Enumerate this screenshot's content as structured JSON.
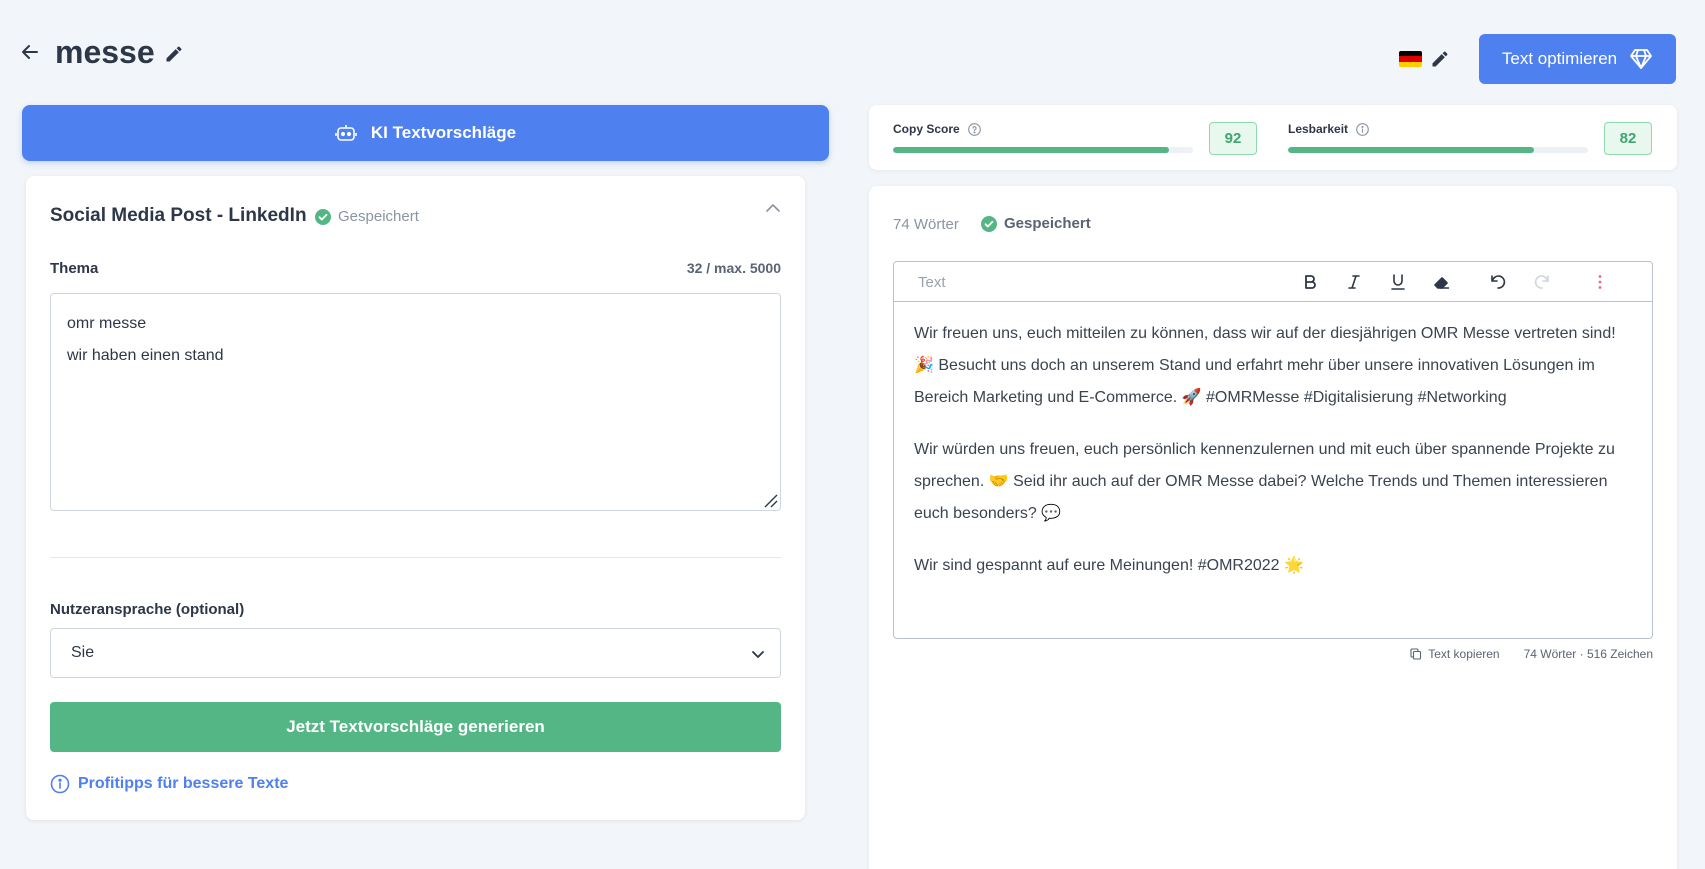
{
  "header": {
    "title": "messe",
    "back_icon": "arrow-left-icon",
    "edit_icon": "pencil-icon",
    "language_flag": "flag-de-icon",
    "optimize_button": "Text optimieren",
    "optimize_icon": "diamond-icon"
  },
  "colors": {
    "primary": "#4f80ef",
    "success": "#55b685",
    "background": "#f2f5f9",
    "text": "#2d3748"
  },
  "left_panel": {
    "ki_button": "KI Textvorschläge",
    "ki_icon": "robot-icon",
    "card_title": "Social Media Post - LinkedIn",
    "saved_status": "Gespeichert",
    "theme_label": "Thema",
    "char_count": "32 / max. 5000",
    "theme_value": "omr messe\nwir haben einen stand",
    "address_label": "Nutzeransprache (optional)",
    "address_selected": "Sie",
    "generate_button": "Jetzt Textvorschläge generieren",
    "tips_link": "Profitipps für bessere Texte"
  },
  "scores": {
    "copy_score": {
      "label": "Copy Score",
      "value": 92
    },
    "readability": {
      "label": "Lesbarkeit",
      "value": 82
    }
  },
  "editor": {
    "word_count": "74 Wörter",
    "saved_status": "Gespeichert",
    "toolbar_placeholder": "Text",
    "toolbar_icons": [
      "bold-icon",
      "italic-icon",
      "underline-icon",
      "eraser-icon",
      "undo-icon",
      "redo-icon",
      "more-vertical-icon"
    ],
    "paragraphs": [
      "Wir freuen uns, euch mitteilen zu können, dass wir auf der diesjährigen OMR Messe vertreten sind! 🎉 Besucht uns doch an unserem Stand und erfahrt mehr über unsere innovativen Lösungen im Bereich Marketing und E-Commerce. 🚀 #OMRMesse #Digitalisierung #Networking",
      "Wir würden uns freuen, euch persönlich kennenzulernen und mit euch über spannende Projekte zu sprechen. 🤝 Seid ihr auch auf der OMR Messe dabei? Welche Trends und Themen interessieren euch besonders? 💬",
      "Wir sind gespannt auf eure Meinungen! #OMR2022 🌟"
    ],
    "copy_text": "Text kopieren",
    "stats": "74 Wörter · 516 Zeichen"
  }
}
